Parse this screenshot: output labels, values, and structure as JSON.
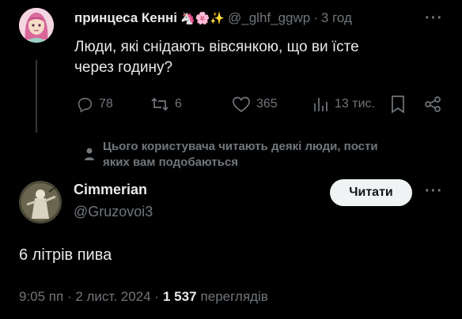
{
  "quoted_post": {
    "author_name": "принцеса Кенні",
    "author_emojis": "🦄🌸✨",
    "handle": "@_glhf_ggwp",
    "separator": "·",
    "time": "3 год",
    "more": "···",
    "text_line1": "Люди, які снідають вівсянкою, що ви їсте",
    "text_line2": "через годину?",
    "actions": {
      "replies": "78",
      "reposts": "6",
      "likes": "365",
      "views": "13 тис."
    }
  },
  "notice": {
    "line1": "Цього користувача читають деякі люди, пости",
    "line2": "яких вам подобаються"
  },
  "reply": {
    "author_name": "Cimmerian",
    "handle": "@Gruzovoi3",
    "follow_label": "Читати",
    "more": "···",
    "text": "6 літрів пива",
    "timestamp": "9:05 пп · 2 лист. 2024 ·",
    "views_count": "1 537",
    "views_label": "переглядів"
  },
  "colors": {
    "background": "#000000",
    "text": "#e7e9ea",
    "muted": "#71767b",
    "button_bg": "#eff3f4"
  }
}
